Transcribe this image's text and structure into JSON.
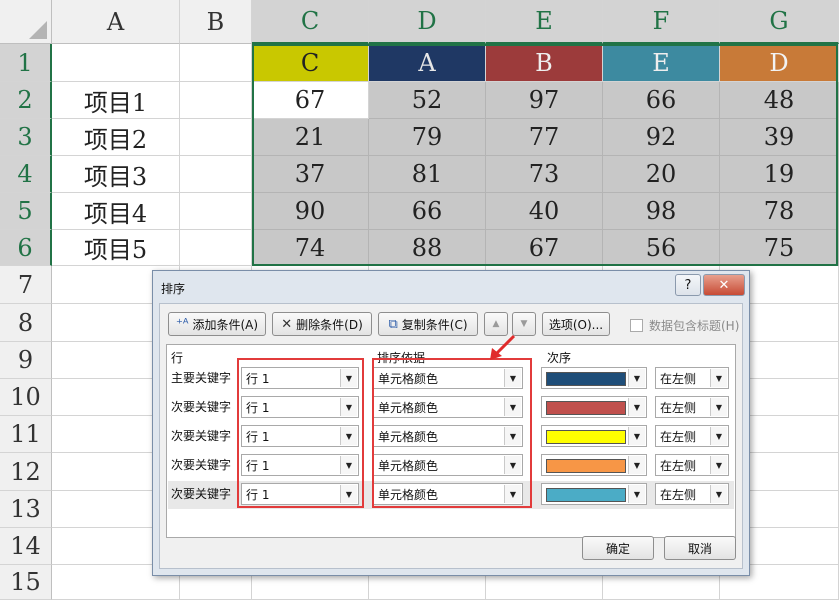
{
  "spreadsheet": {
    "columns": [
      "A",
      "B",
      "C",
      "D",
      "E",
      "F",
      "G"
    ],
    "rows": [
      "1",
      "2",
      "3",
      "4",
      "5",
      "6",
      "7",
      "8",
      "9",
      "10",
      "11",
      "12",
      "13",
      "14",
      "15"
    ],
    "header_row": [
      "C",
      "A",
      "B",
      "E",
      "D"
    ],
    "items": [
      "项目1",
      "项目2",
      "项目3",
      "项目4",
      "项目5"
    ],
    "values": [
      [
        "67",
        "52",
        "97",
        "66",
        "48"
      ],
      [
        "21",
        "79",
        "77",
        "92",
        "39"
      ],
      [
        "37",
        "81",
        "73",
        "20",
        "19"
      ],
      [
        "90",
        "66",
        "40",
        "98",
        "78"
      ],
      [
        "74",
        "88",
        "67",
        "56",
        "75"
      ]
    ],
    "colors": {
      "C": "#c9c800",
      "A": "#1f3864",
      "B": "#9c3b3b",
      "E": "#3d8aa0",
      "D": "#c87a38",
      "selection": "#217346"
    }
  },
  "dialog": {
    "title": "排序",
    "help": "?",
    "close": "✕",
    "toolbar": {
      "add": "添加条件(A)",
      "delete": "删除条件(D)",
      "copy": "复制条件(C)",
      "up": "▲",
      "down": "▼",
      "options": "选项(O)...",
      "has_header": "数据包含标题(H)"
    },
    "columns": {
      "row": "行",
      "sort_on": "排序依据",
      "order": "次序"
    },
    "levels": [
      {
        "label": "主要关键字",
        "key": "行 1",
        "sort_on": "单元格颜色",
        "color": "#1f4e79",
        "position": "在左侧"
      },
      {
        "label": "次要关键字",
        "key": "行 1",
        "sort_on": "单元格颜色",
        "color": "#c0504d",
        "position": "在左侧"
      },
      {
        "label": "次要关键字",
        "key": "行 1",
        "sort_on": "单元格颜色",
        "color": "#ffff00",
        "position": "在左侧"
      },
      {
        "label": "次要关键字",
        "key": "行 1",
        "sort_on": "单元格颜色",
        "color": "#f79646",
        "position": "在左侧"
      },
      {
        "label": "次要关键字",
        "key": "行 1",
        "sort_on": "单元格颜色",
        "color": "#4bacc6",
        "position": "在左侧"
      }
    ],
    "ok": "确定",
    "cancel": "取消"
  }
}
